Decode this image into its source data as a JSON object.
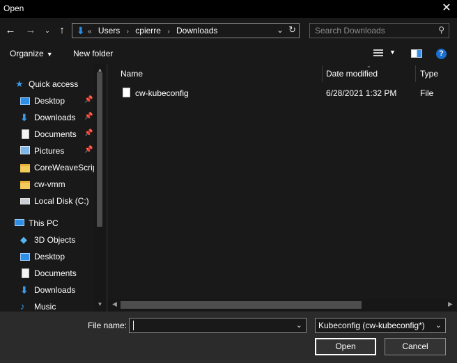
{
  "window": {
    "title": "Open"
  },
  "address": {
    "prefix": "«",
    "crumbs": [
      "Users",
      "cpierre",
      "Downloads"
    ],
    "separator": "›"
  },
  "search": {
    "placeholder": "Search Downloads"
  },
  "toolbar": {
    "organize_label": "Organize",
    "new_folder_label": "New folder"
  },
  "nav": {
    "quick_access": "Quick access",
    "items": [
      {
        "label": "Desktop",
        "icon": "desktop-icon",
        "pinned": true
      },
      {
        "label": "Downloads",
        "icon": "download-arrow-icon",
        "pinned": true
      },
      {
        "label": "Documents",
        "icon": "documents-icon",
        "pinned": true
      },
      {
        "label": "Pictures",
        "icon": "pictures-icon",
        "pinned": true
      },
      {
        "label": "CoreWeaveScrip",
        "icon": "folder-icon",
        "pinned": false
      },
      {
        "label": "cw-vmm",
        "icon": "folder-icon",
        "pinned": false
      },
      {
        "label": "Local Disk (C:)",
        "icon": "drive-icon",
        "pinned": false
      }
    ],
    "this_pc": "This PC",
    "pc_items": [
      {
        "label": "3D Objects",
        "icon": "3d-objects-icon"
      },
      {
        "label": "Desktop",
        "icon": "desktop-icon"
      },
      {
        "label": "Documents",
        "icon": "documents-icon"
      },
      {
        "label": "Downloads",
        "icon": "download-arrow-icon"
      },
      {
        "label": "Music",
        "icon": "music-icon"
      }
    ]
  },
  "columns": {
    "name": "Name",
    "date_modified": "Date modified",
    "type": "Type"
  },
  "files": [
    {
      "name": "cw-kubeconfig",
      "date_modified": "6/28/2021 1:32 PM",
      "type": "File"
    }
  ],
  "footer": {
    "file_name_label": "File name:",
    "file_name_value": "",
    "file_type": "Kubeconfig (cw-kubeconfig*)",
    "open_label": "Open",
    "cancel_label": "Cancel"
  },
  "colors": {
    "accent": "#2b8be0",
    "background": "#191919",
    "titlebar": "#000000",
    "footer": "#2b2b2b"
  }
}
